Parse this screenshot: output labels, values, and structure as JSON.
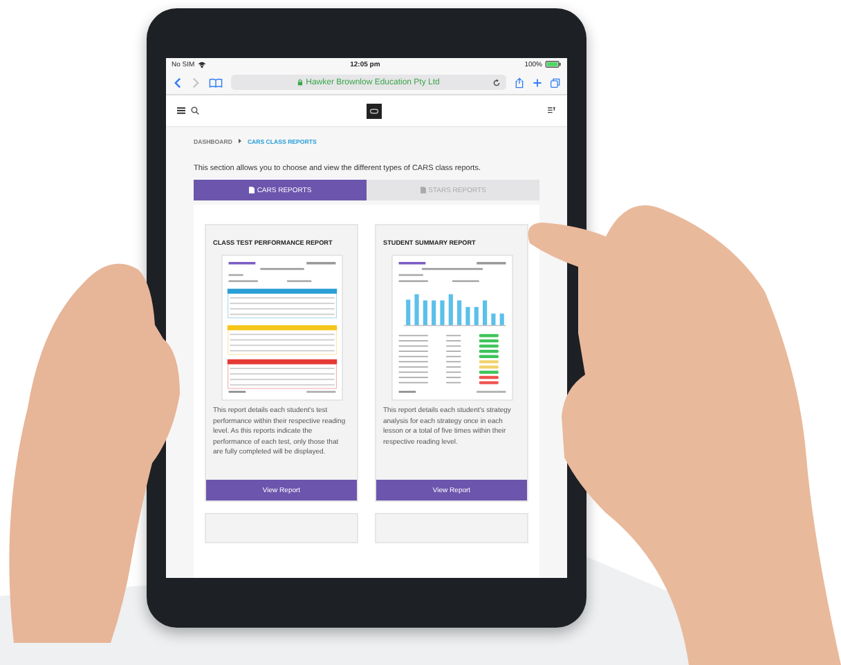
{
  "status_bar": {
    "carrier": "No SIM",
    "time": "12:05 pm",
    "battery": "100%"
  },
  "browser": {
    "url": "Hawker Brownlow Education Pty Ltd"
  },
  "breadcrumb": [
    {
      "label": "DASHBOARD",
      "selected": false
    },
    {
      "label": "CARS CLASS REPORTS",
      "selected": true
    }
  ],
  "intro": "This section allows you to choose and view the different types of CARS class reports.",
  "tabs": [
    {
      "label": "CARS REPORTS",
      "selected": true
    },
    {
      "label": "STARS REPORTS",
      "selected": false
    }
  ],
  "cards": [
    {
      "title": "CLASS TEST PERFORMANCE REPORT",
      "kind": "table",
      "description": "This report details each student's test performance within their respective reading level. As this reports indicate the performance of each test, only those that are fully completed will be displayed.",
      "button": "View Report"
    },
    {
      "title": "STUDENT SUMMARY REPORT",
      "kind": "chart",
      "description": "This report details each student's strategy analysis for each strategy once in each lesson or a total of five times within their respective reading level.",
      "button": "View Report"
    }
  ]
}
